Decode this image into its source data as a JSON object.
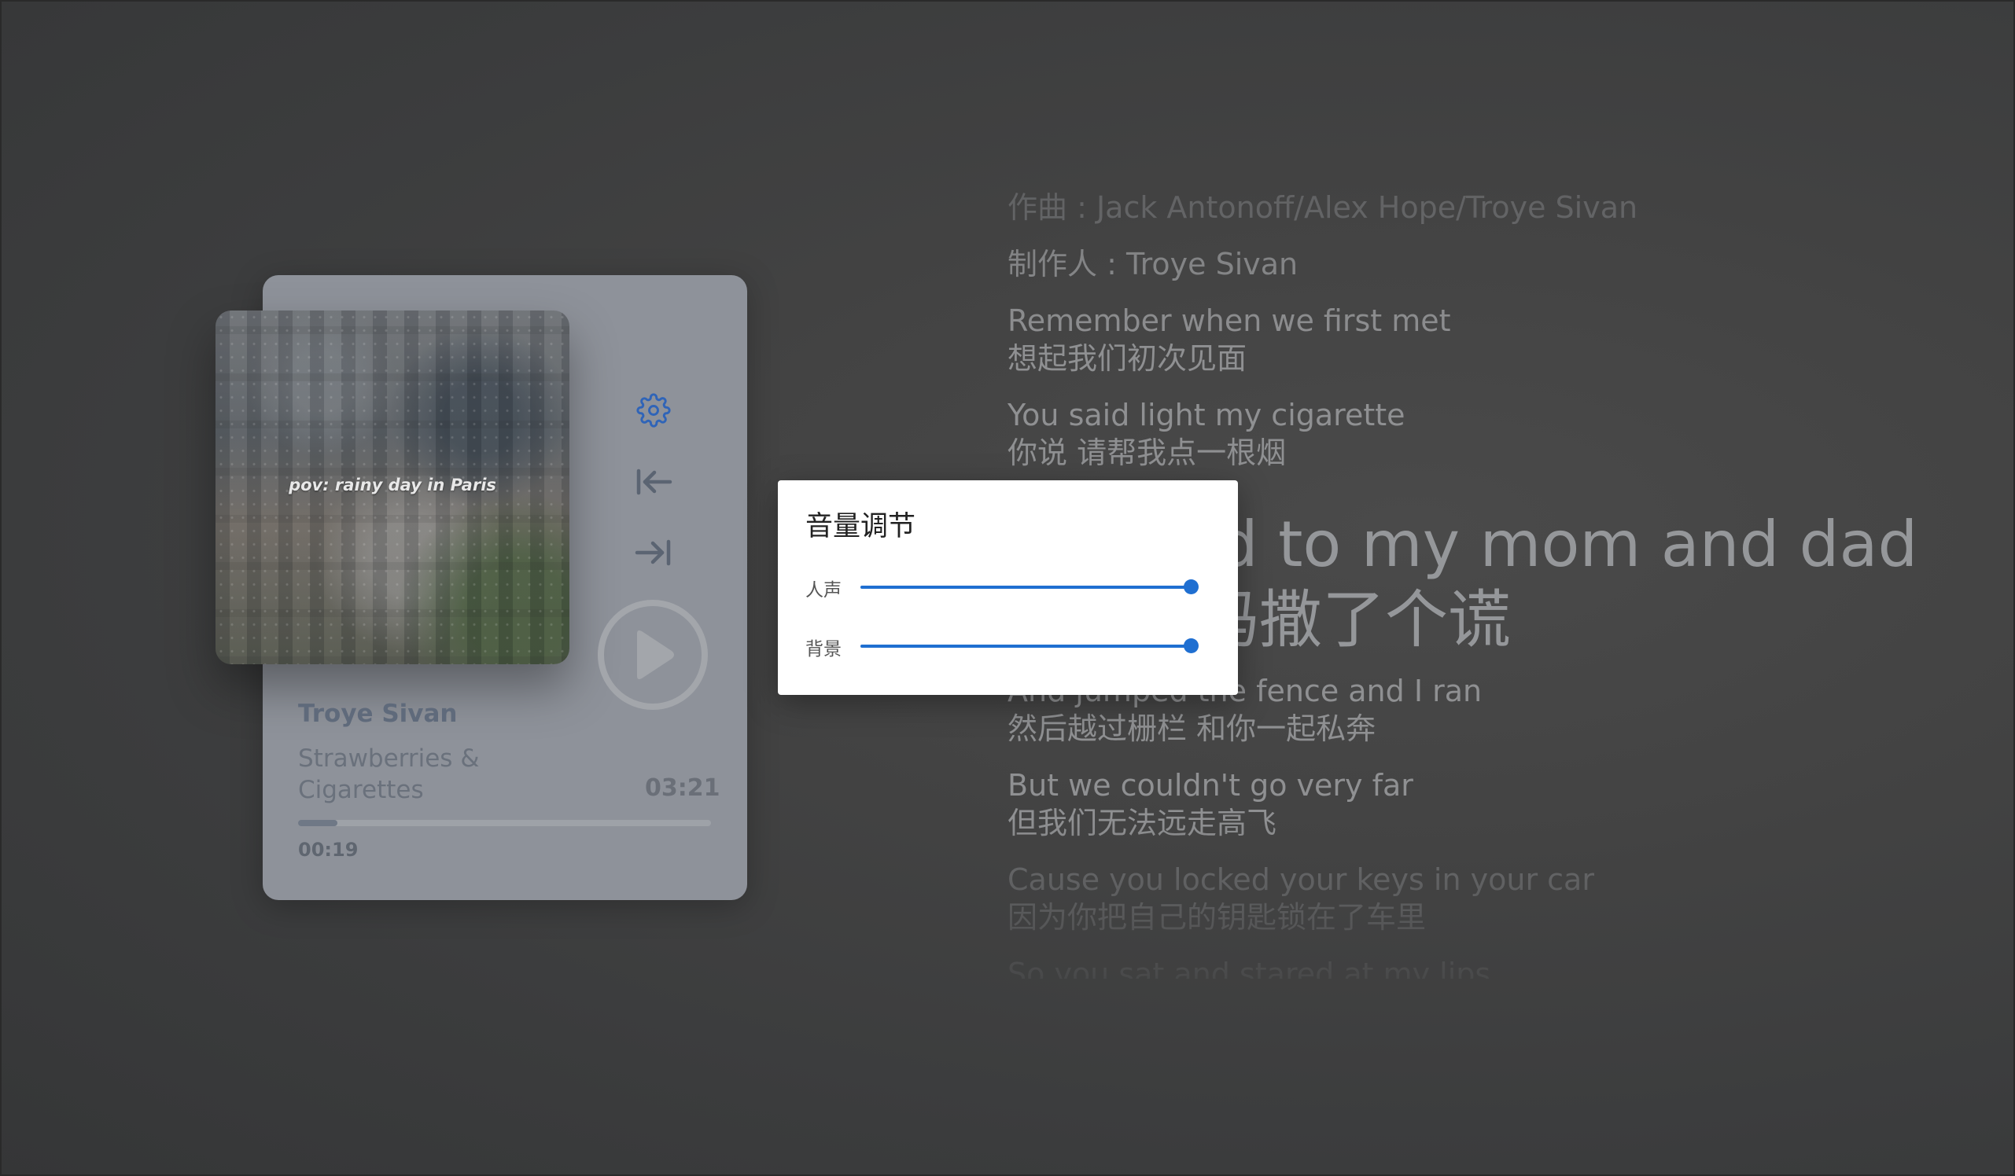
{
  "player": {
    "album_caption": "pov: rainy day in Paris",
    "artist": "Troye Sivan",
    "title": "Strawberries & Cigarettes",
    "duration": "03:21",
    "elapsed": "00:19",
    "progress": 0.095,
    "accent_color": "#2f64b8",
    "icons": [
      "gear-icon",
      "skip-previous-icon",
      "skip-next-icon",
      "play-icon"
    ]
  },
  "lyrics": {
    "lines": [
      {
        "text": "作曲 : Jack Antonoff/Alex Hope/Troye Sivan",
        "translation": "",
        "state": "dim"
      },
      {
        "text": "制作人 : Troye Sivan",
        "translation": "",
        "state": "normal"
      },
      {
        "text": "Remember when we first met",
        "translation": "想起我们初次见面",
        "state": "normal"
      },
      {
        "text": "You said light my cigarette",
        "translation": "你说 请帮我点一根烟",
        "state": "normal"
      },
      {
        "text": "So I lied to my mom and dad",
        "translation": "我对爸妈撒了个谎",
        "state": "active"
      },
      {
        "text": "And jumped the fence and I ran",
        "translation": "然后越过栅栏 和你一起私奔",
        "state": "normal"
      },
      {
        "text": "But we couldn't go very far",
        "translation": "但我们无法远走高飞",
        "state": "normal"
      },
      {
        "text": "Cause you locked your keys in your car",
        "translation": "因为你把自己的钥匙锁在了车里",
        "state": "dim"
      },
      {
        "text": "So you sat and stared at my lips",
        "translation": "",
        "state": "dim"
      }
    ]
  },
  "volume_dialog": {
    "title": "音量调节",
    "sliders": [
      {
        "label": "人声",
        "value": 1.0
      },
      {
        "label": "背景",
        "value": 1.0
      }
    ],
    "accent_color": "#1f6fd1"
  }
}
